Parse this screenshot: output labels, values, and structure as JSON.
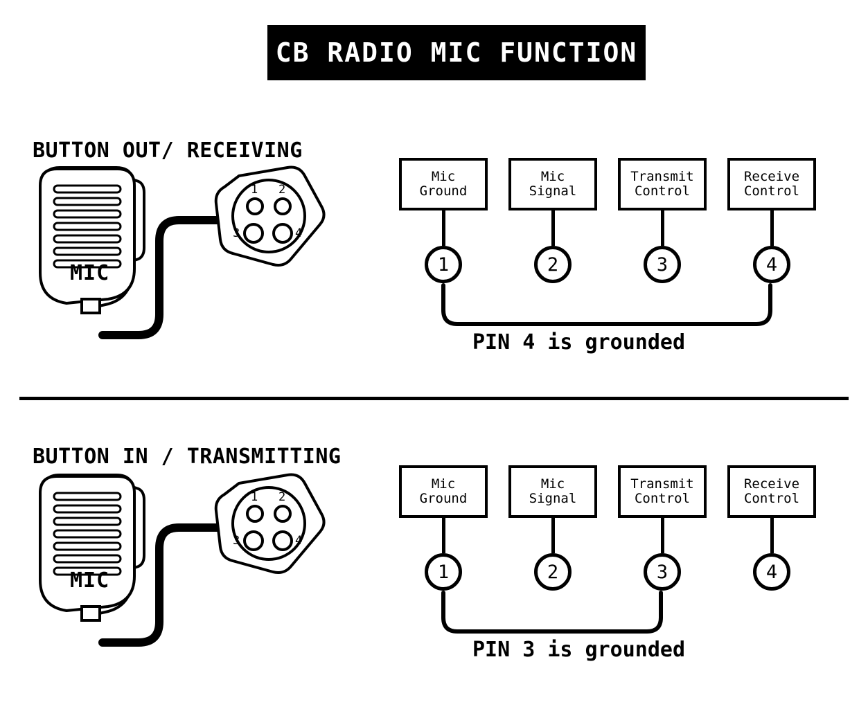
{
  "title": "CB RADIO MIC FUNCTION",
  "divider": "section-divider",
  "sections": [
    {
      "heading": "BUTTON OUT/ RECEIVING",
      "mic_label": "MIC",
      "connector": {
        "pin_labels": [
          "1",
          "2",
          "3",
          "4"
        ]
      },
      "pins": [
        {
          "number": "1",
          "box_line1": "Mic",
          "box_line2": "Ground"
        },
        {
          "number": "2",
          "box_line1": "Mic",
          "box_line2": "Signal"
        },
        {
          "number": "3",
          "box_line1": "Transmit",
          "box_line2": "Control"
        },
        {
          "number": "4",
          "box_line1": "Receive",
          "box_line2": "Control"
        }
      ],
      "grounded_pin": "4",
      "caption": "PIN 4 is grounded"
    },
    {
      "heading": "BUTTON IN / TRANSMITTING",
      "mic_label": "MIC",
      "connector": {
        "pin_labels": [
          "1",
          "2",
          "3",
          "4"
        ]
      },
      "pins": [
        {
          "number": "1",
          "box_line1": "Mic",
          "box_line2": "Ground"
        },
        {
          "number": "2",
          "box_line1": "Mic",
          "box_line2": "Signal"
        },
        {
          "number": "3",
          "box_line1": "Transmit",
          "box_line2": "Control"
        },
        {
          "number": "4",
          "box_line1": "Receive",
          "box_line2": "Control"
        }
      ],
      "grounded_pin": "3",
      "caption": "PIN 3 is grounded"
    }
  ],
  "colors": {
    "ink": "#000000",
    "paper": "#ffffff",
    "banner_bg": "#000000",
    "banner_fg": "#ffffff"
  }
}
